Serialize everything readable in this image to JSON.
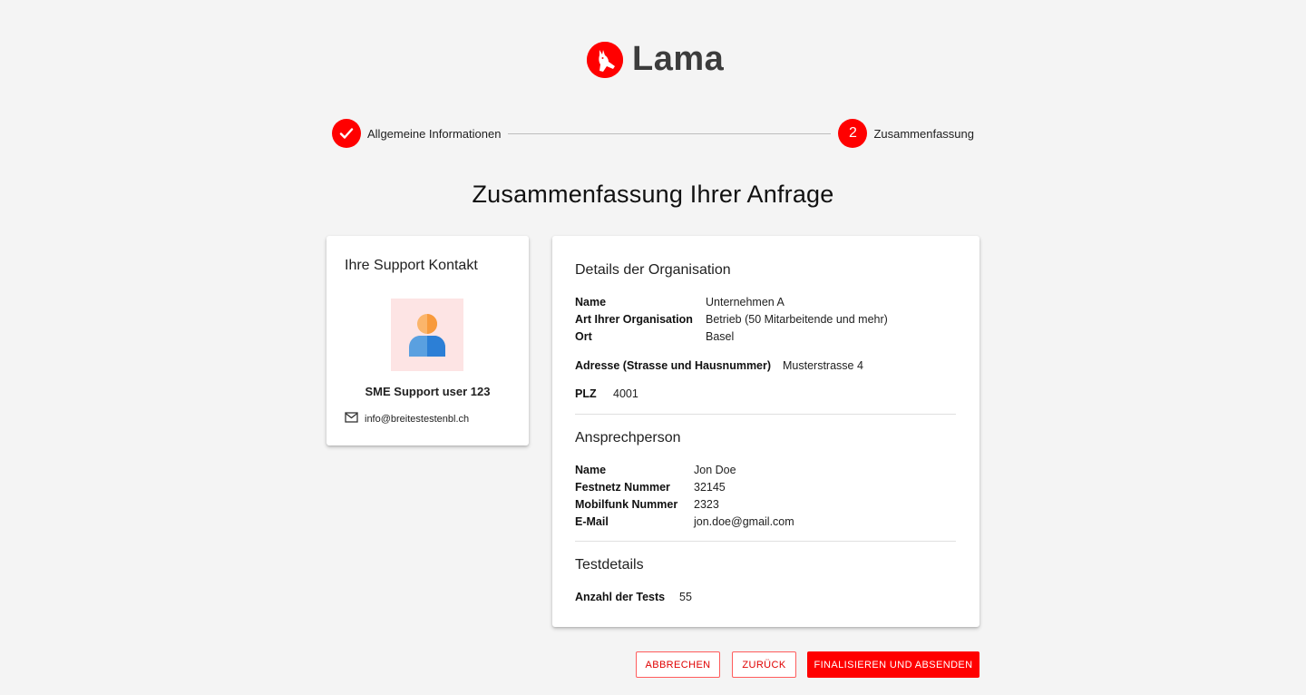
{
  "app": {
    "name": "Lama",
    "brand_color": "#ff0000"
  },
  "stepper": {
    "steps": [
      {
        "label": "Allgemeine Informationen",
        "state": "completed",
        "icon": "check-icon"
      },
      {
        "label": "Zusammenfassung",
        "state": "active",
        "number": "2"
      }
    ]
  },
  "page": {
    "title": "Zusammenfassung Ihrer Anfrage"
  },
  "contact": {
    "title": "Ihre Support Kontakt",
    "avatar_icon": "user-avatar-icon",
    "name": "SME Support user 123",
    "email_icon": "mail-icon",
    "email": "info@breitestestenbl.ch"
  },
  "organisation": {
    "title": "Details der Organisation",
    "name_label": "Name",
    "name_value": "Unternehmen A",
    "type_label": "Art Ihrer Organisation",
    "type_value": "Betrieb (50 Mitarbeitende und mehr)",
    "city_label": "Ort",
    "city_value": "Basel",
    "address_label": "Adresse (Strasse und Hausnummer)",
    "address_value": "Musterstrasse 4",
    "zip_label": "PLZ",
    "zip_value": "4001"
  },
  "person": {
    "title": "Ansprechperson",
    "name_label": "Name",
    "name_value": "Jon Doe",
    "phone_label": "Festnetz Nummer",
    "phone_value": "32145",
    "mobile_label": "Mobilfunk Nummer",
    "mobile_value": "2323",
    "email_label": "E-Mail",
    "email_value": "jon.doe@gmail.com"
  },
  "tests": {
    "title": "Testdetails",
    "count_label": "Anzahl der Tests",
    "count_value": "55"
  },
  "actions": {
    "cancel": "ABBRECHEN",
    "back": "ZURÜCK",
    "submit": "FINALISIEREN UND ABSENDEN"
  }
}
